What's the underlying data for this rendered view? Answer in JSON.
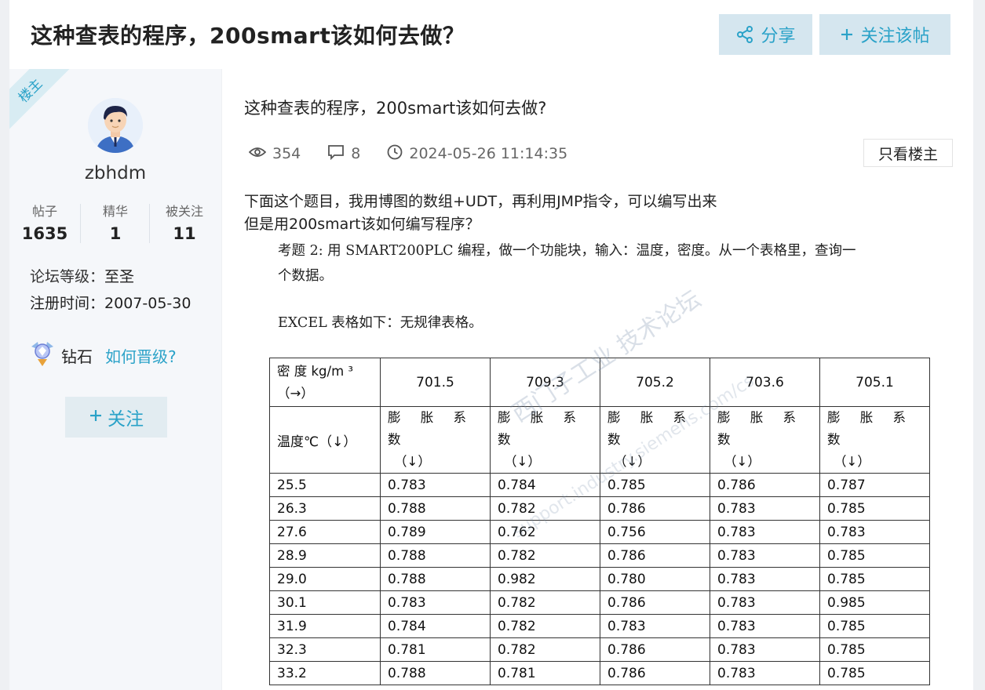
{
  "header": {
    "title": "这种查表的程序，200smart该如何去做？",
    "share_label": "分享",
    "follow_post_label": "关注该帖",
    "accent_color": "#2aa2c8"
  },
  "author": {
    "badge": "楼主",
    "username": "zbhdm",
    "stats": [
      {
        "label": "帖子",
        "value": "1635"
      },
      {
        "label": "精华",
        "value": "1"
      },
      {
        "label": "被关注",
        "value": "11"
      }
    ],
    "level_key": "论坛等级：",
    "level_value": "至圣",
    "register_key": "注册时间：",
    "register_value": "2007-05-30",
    "rank_name": "钻石",
    "rank_link": "如何晋级?",
    "follow_label": "关注"
  },
  "post": {
    "title": "这种查表的程序，200smart该如何去做?",
    "views": "354",
    "comments": "8",
    "datetime": "2024-05-26 11:14:35",
    "only_op_label": "只看楼主",
    "body_lines": [
      "下面这个题目，我用博图的数组+UDT，再利用JMP指令，可以编写出来",
      "但是用200smart该如何编写程序？"
    ]
  },
  "image": {
    "para1_line1": "考题 2: 用 SMART200PLC 编程，做一个功能块，输入：温度，密度。从一个表格里，查询一",
    "para1_line2": "个数据。",
    "para2": "EXCEL 表格如下：无规律表格。",
    "watermark": "西门子工业 技术论坛",
    "watermark_url": "support.industry.siemens.com/cs",
    "table": {
      "corner_top": "密 度 kg/m ³",
      "corner_arrow": "（→）",
      "density_headers": [
        "701.5",
        "709.3",
        "705.2",
        "703.6",
        "705.1"
      ],
      "temp_label": "温度℃（↓）",
      "coef_label": "膨 胀 系 数",
      "coef_arrow": "（↓）",
      "rows": [
        [
          "25.5",
          "0.783",
          "0.784",
          "0.785",
          "0.786",
          "0.787"
        ],
        [
          "26.3",
          "0.788",
          "0.782",
          "0.786",
          "0.783",
          "0.785"
        ],
        [
          "27.6",
          "0.789",
          "0.762",
          "0.756",
          "0.783",
          "0.783"
        ],
        [
          "28.9",
          "0.788",
          "0.782",
          "0.786",
          "0.783",
          "0.785"
        ],
        [
          "29.0",
          "0.788",
          "0.982",
          "0.780",
          "0.783",
          "0.785"
        ],
        [
          "30.1",
          "0.783",
          "0.782",
          "0.786",
          "0.783",
          "0.985"
        ],
        [
          "31.9",
          "0.784",
          "0.782",
          "0.783",
          "0.783",
          "0.785"
        ],
        [
          "32.3",
          "0.781",
          "0.782",
          "0.786",
          "0.783",
          "0.785"
        ],
        [
          "33.2",
          "0.788",
          "0.781",
          "0.786",
          "0.783",
          "0.785"
        ]
      ]
    }
  }
}
